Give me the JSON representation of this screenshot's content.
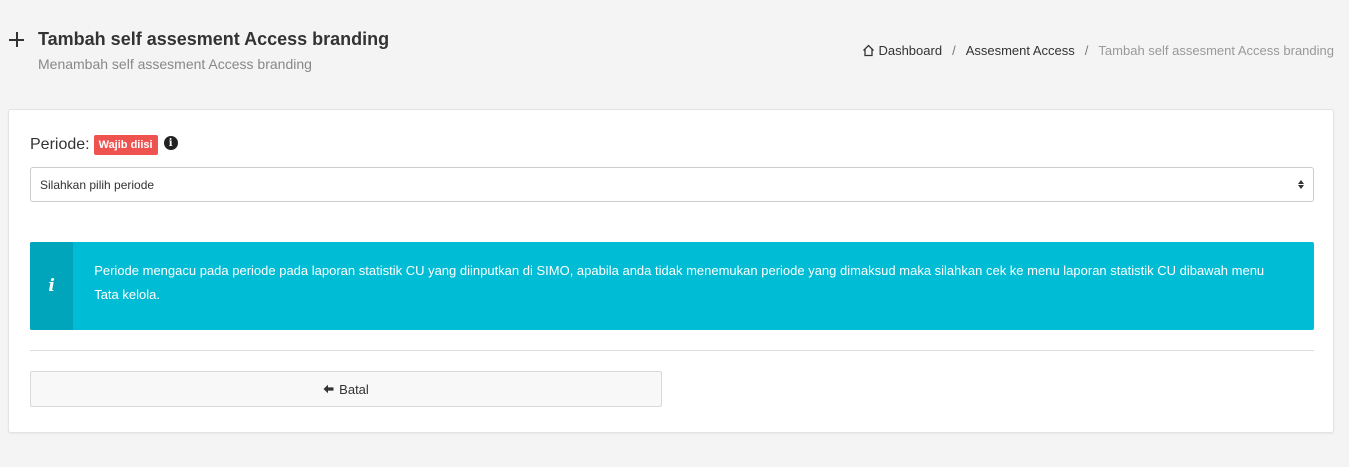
{
  "header": {
    "icon": "plus-icon",
    "title": "Tambah self assesment Access branding",
    "subtitle": "Menambah self assesment Access branding"
  },
  "breadcrumb": {
    "home_icon": "home-icon",
    "items": [
      {
        "label": "Dashboard"
      },
      {
        "label": "Assesment Access"
      },
      {
        "label": "Tambah self assesment Access branding"
      }
    ],
    "separator": "/"
  },
  "form": {
    "periode_label": "Periode:",
    "required_badge": "Wajib diisi",
    "required_badge_color": "#ef5350",
    "info_icon": "info-circle-icon",
    "periode_select_value": "Silahkan pilih periode"
  },
  "alert": {
    "icon": "info-icon",
    "icon_glyph": "i",
    "color": "#00bcd4",
    "text": "Periode mengacu pada periode pada laporan statistik CU yang diinputkan di SIMO, apabila anda tidak menemukan periode yang dimaksud maka silahkan cek ke menu laporan statistik CU dibawah menu Tata kelola."
  },
  "actions": {
    "cancel_icon": "arrow-left-icon",
    "cancel_label": "Batal"
  }
}
